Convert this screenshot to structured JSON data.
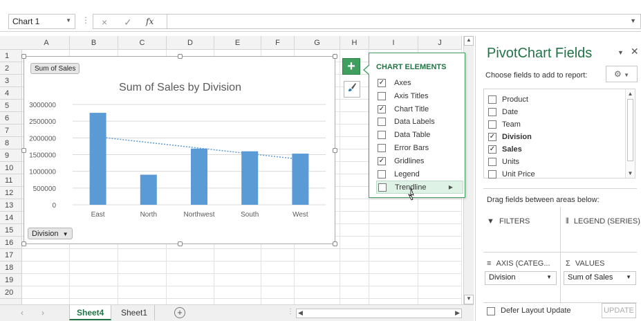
{
  "formula_bar": {
    "name_box": "Chart 1",
    "cancel_icon": "×",
    "enter_icon": "✓",
    "fx_label": "fx",
    "formula": ""
  },
  "columns": [
    "A",
    "B",
    "C",
    "D",
    "E",
    "F",
    "G",
    "H",
    "I",
    "J"
  ],
  "rows": [
    "1",
    "2",
    "3",
    "4",
    "5",
    "6",
    "7",
    "8",
    "9",
    "10",
    "11",
    "12",
    "13",
    "14",
    "15",
    "16",
    "17",
    "18",
    "19",
    "20"
  ],
  "sheets": {
    "tabs": [
      "Sheet4",
      "Sheet1"
    ],
    "active": "Sheet4",
    "add_label": "+"
  },
  "chart": {
    "field_button": "Sum of Sales",
    "axis_button": "Division",
    "chart_data": {
      "type": "bar",
      "title": "Sum of Sales by Division",
      "categories": [
        "East",
        "North",
        "Northwest",
        "South",
        "West"
      ],
      "values": [
        2750000,
        900000,
        1680000,
        1600000,
        1530000
      ],
      "ylim": [
        0,
        3000000
      ],
      "yticks": [
        "0",
        "500000",
        "1000000",
        "1500000",
        "2000000",
        "2500000",
        "3000000"
      ],
      "trendline": {
        "type": "linear",
        "start": 2030000,
        "end": 1360000
      },
      "grid": true,
      "bar_color": "#5b9bd5"
    }
  },
  "chart_buttons": {
    "plus": "+",
    "brush_icon": "paintbrush-icon"
  },
  "chart_elements": {
    "title": "CHART ELEMENTS",
    "items": [
      {
        "label": "Axes",
        "checked": true
      },
      {
        "label": "Axis Titles",
        "checked": false
      },
      {
        "label": "Chart Title",
        "checked": true
      },
      {
        "label": "Data Labels",
        "checked": false
      },
      {
        "label": "Data Table",
        "checked": false
      },
      {
        "label": "Error Bars",
        "checked": false
      },
      {
        "label": "Gridlines",
        "checked": true
      },
      {
        "label": "Legend",
        "checked": false
      },
      {
        "label": "Trendline",
        "checked": false,
        "highlighted": true
      }
    ]
  },
  "pivot_pane": {
    "title": "PivotChart Fields",
    "subtitle": "Choose fields to add to report:",
    "fields": [
      {
        "label": "Product",
        "checked": false
      },
      {
        "label": "Date",
        "checked": false
      },
      {
        "label": "Team",
        "checked": false
      },
      {
        "label": "Division",
        "checked": true
      },
      {
        "label": "Sales",
        "checked": true
      },
      {
        "label": "Units",
        "checked": false
      },
      {
        "label": "Unit Price",
        "checked": false
      }
    ],
    "drag_text": "Drag fields between areas below:",
    "areas": {
      "filters": "FILTERS",
      "legend": "LEGEND (SERIES)",
      "axis": "AXIS (CATEG...",
      "values": "VALUES",
      "axis_value": "Division",
      "values_value": "Sum of Sales"
    },
    "defer": "Defer Layout Update",
    "update": "UPDATE"
  }
}
